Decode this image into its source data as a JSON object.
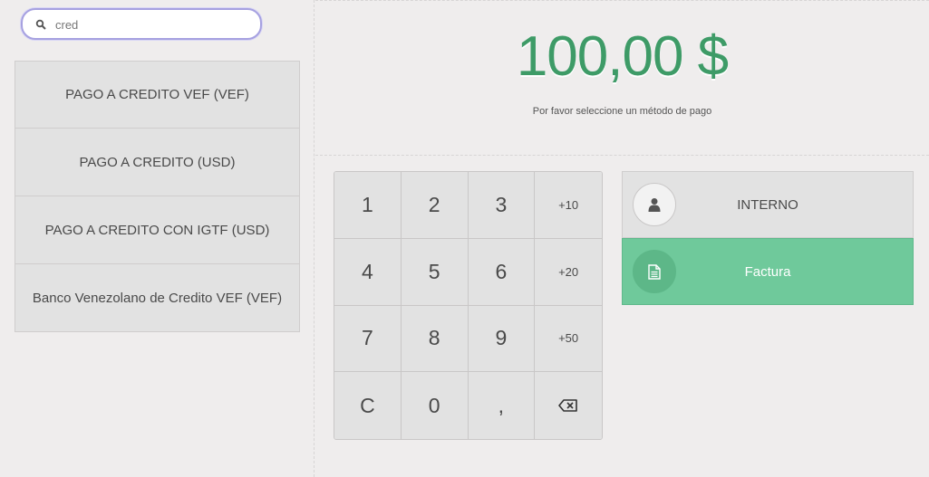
{
  "search": {
    "value": "cred",
    "placeholder": ""
  },
  "payment_methods": [
    "PAGO A CREDITO VEF (VEF)",
    "PAGO A CREDITO (USD)",
    "PAGO A CREDITO CON IGTF (USD)",
    "Banco Venezolano de Credito VEF (VEF)"
  ],
  "summary": {
    "amount": "100,00 $",
    "hint": "Por favor seleccione un método de pago"
  },
  "numpad": {
    "keys": [
      "1",
      "2",
      "3",
      "+10",
      "4",
      "5",
      "6",
      "+20",
      "7",
      "8",
      "9",
      "+50",
      "C",
      "0",
      ",",
      ""
    ],
    "backspace_icon": "backspace-icon"
  },
  "buttons": {
    "customer": {
      "label": "INTERNO",
      "icon": "user-icon"
    },
    "invoice": {
      "label": "Factura",
      "icon": "document-icon"
    }
  },
  "colors": {
    "accent_green": "#3e9b67",
    "selected_green": "#6fc99b",
    "search_border": "#a6a1e0"
  }
}
